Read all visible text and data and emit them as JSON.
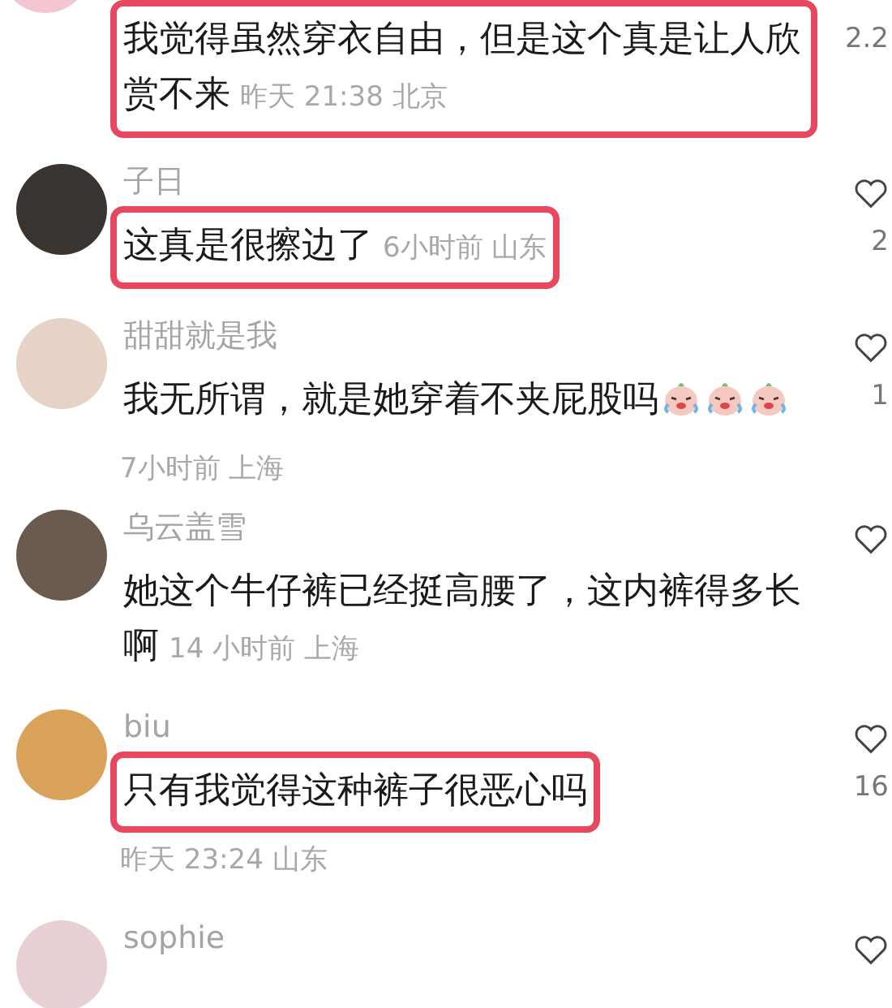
{
  "comments": [
    {
      "text": "我觉得虽然穿衣自由，但是这个真是让人欣赏不来",
      "meta": "昨天 21:38 北京",
      "likes": "2.2",
      "like_icon": false,
      "highlighted": true,
      "meta_inline": true
    },
    {
      "username": "子日",
      "text": "这真是很擦边了",
      "meta": "6小时前 山东",
      "likes": "2",
      "like_icon": true,
      "highlighted": true,
      "meta_inline": true
    },
    {
      "username": "甜甜就是我",
      "text": "我无所谓，就是她穿着不夹屁股吗",
      "emojis": [
        {
          "kind": "crying"
        },
        {
          "kind": "crying"
        },
        {
          "kind": "crying"
        }
      ],
      "meta": "7小时前 上海",
      "likes": "1",
      "like_icon": true,
      "highlighted": false,
      "meta_inline": false
    },
    {
      "username": "乌云盖雪",
      "text": "她这个牛仔裤已经挺高腰了，这内裤得多长啊",
      "meta": "14 小时前 上海",
      "like_icon": true,
      "highlighted": false,
      "meta_inline": true
    },
    {
      "username": "biu",
      "text": "只有我觉得这种裤子很恶心吗",
      "meta": "昨天 23:24 山东",
      "likes": "16",
      "like_icon": true,
      "highlighted": true,
      "meta_inline": false
    },
    {
      "username": "sophie",
      "like_icon": true
    }
  ]
}
